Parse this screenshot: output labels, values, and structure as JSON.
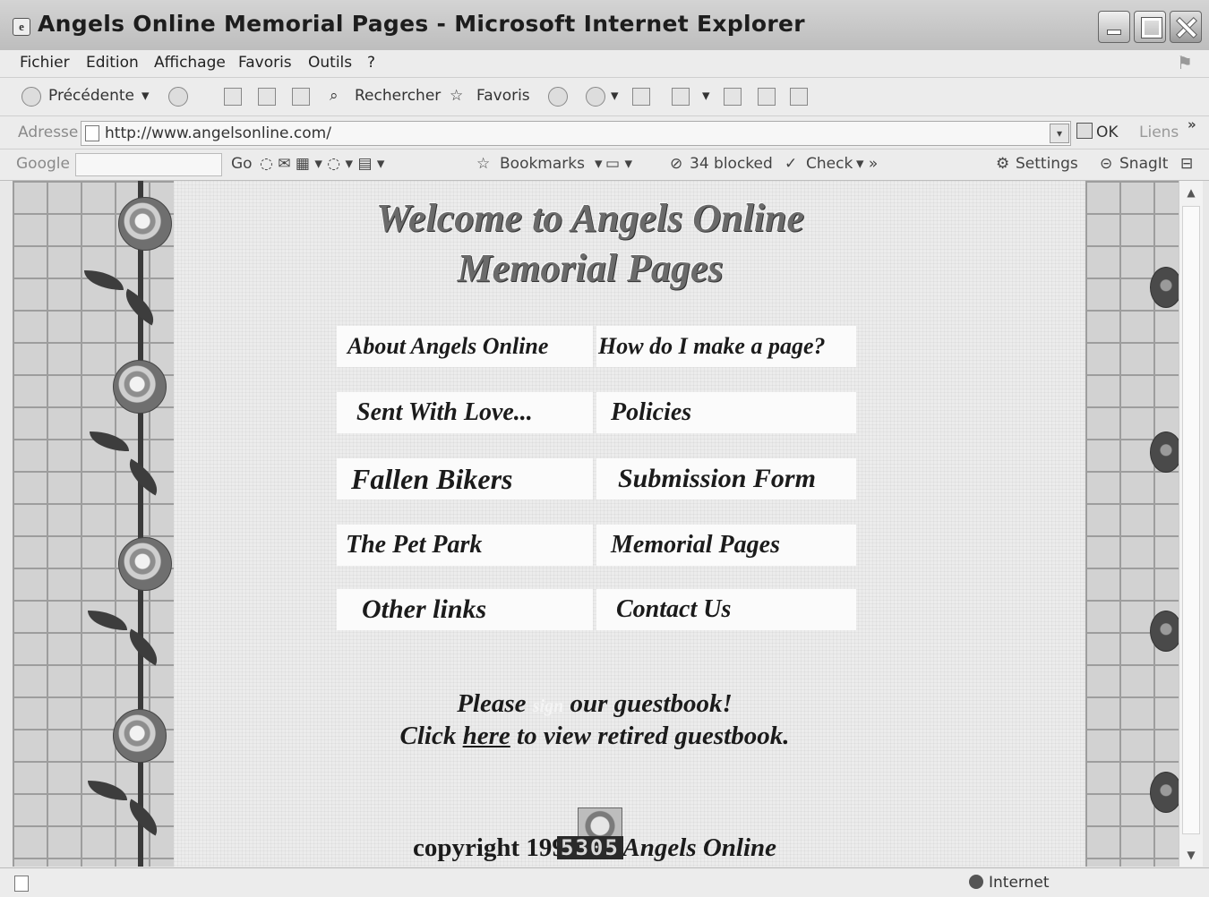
{
  "window": {
    "title": "Angels Online Memorial Pages - Microsoft Internet Explorer"
  },
  "menu": [
    "Fichier",
    "Edition",
    "Affichage",
    "Favoris",
    "Outils",
    "?"
  ],
  "toolbar": {
    "back_label": "Précédente",
    "search_label": "Rechercher",
    "favorites_label": "Favoris"
  },
  "address": {
    "label": "Adresse",
    "url": "http://www.angelsonline.com/",
    "go_label": "OK",
    "links_label": "Liens"
  },
  "googlebar": {
    "logo": "Google",
    "go_label": "Go",
    "bookmarks_label": "Bookmarks",
    "blocked_label": "34 blocked",
    "check_label": "Check",
    "settings_label": "Settings",
    "snagit_label": "SnagIt"
  },
  "page": {
    "welcome_line1": "Welcome to Angels Online",
    "welcome_line2": "Memorial Pages",
    "nav": [
      "About Angels Online",
      "How do I make a page?",
      "Sent With Love...",
      "Policies",
      "Fallen Bikers",
      "Submission Form",
      "The Pet Park",
      "Memorial Pages",
      "Other links",
      "Contact Us"
    ],
    "guestbook": {
      "please": "Please",
      "sign": "sign",
      "rest": "our guestbook!",
      "click": "Click",
      "here": "here",
      "retired": "to view retired guestbook."
    },
    "copyright_prefix": "copyright 1997",
    "copyright_suffix": "Angels Online",
    "counter": "5305"
  },
  "status": {
    "zone": "Internet"
  }
}
